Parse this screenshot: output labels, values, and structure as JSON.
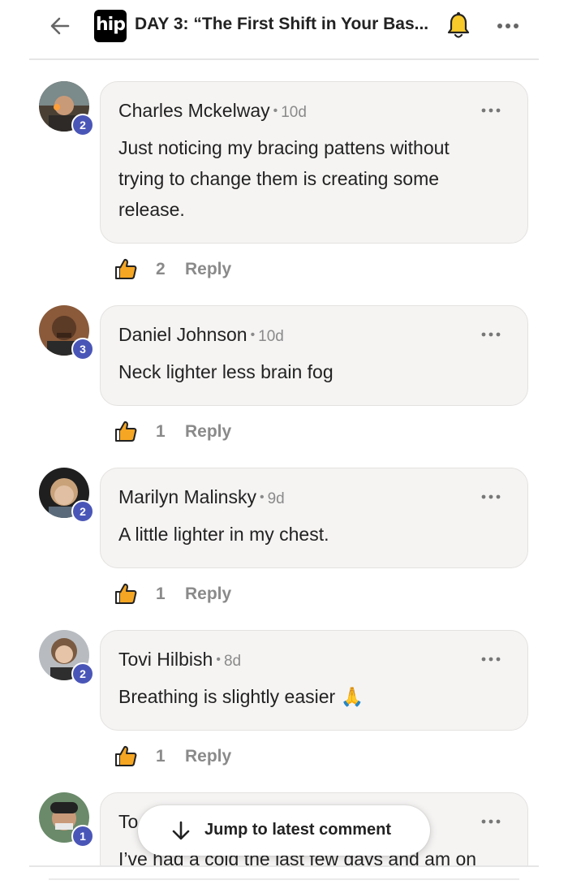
{
  "header": {
    "logo_text": "hip",
    "title": "DAY 3: “The First Shift in Your Bas..."
  },
  "comments": [
    {
      "author": "Charles Mckelway",
      "time": "10d",
      "level": "2",
      "text": "Just noticing my bracing pattens without trying to change them is creating some release.",
      "likes": "2",
      "reply_label": "Reply"
    },
    {
      "author": "Daniel Johnson",
      "time": "10d",
      "level": "3",
      "text": "Neck lighter less brain fog",
      "likes": "1",
      "reply_label": "Reply"
    },
    {
      "author": "Marilyn Malinsky",
      "time": "9d",
      "level": "2",
      "text": "A little lighter in my chest.",
      "likes": "1",
      "reply_label": "Reply"
    },
    {
      "author": "Tovi Hilbish",
      "time": "8d",
      "level": "2",
      "text": "Breathing is slightly easier 🙏",
      "likes": "1",
      "reply_label": "Reply"
    },
    {
      "author": "To",
      "time": "",
      "level": "1",
      "text": "I’ve had a cold the last few days and am on",
      "likes": "",
      "reply_label": ""
    }
  ],
  "jump_label": "Jump to latest comment",
  "colors": {
    "level_badge": "#4a56b7",
    "bubble_bg": "#f5f4f3",
    "like_icon": "#f0a020"
  },
  "icons": [
    "back-arrow-icon",
    "bell-icon",
    "more-icon",
    "thumbs-up-icon",
    "down-arrow-icon"
  ]
}
